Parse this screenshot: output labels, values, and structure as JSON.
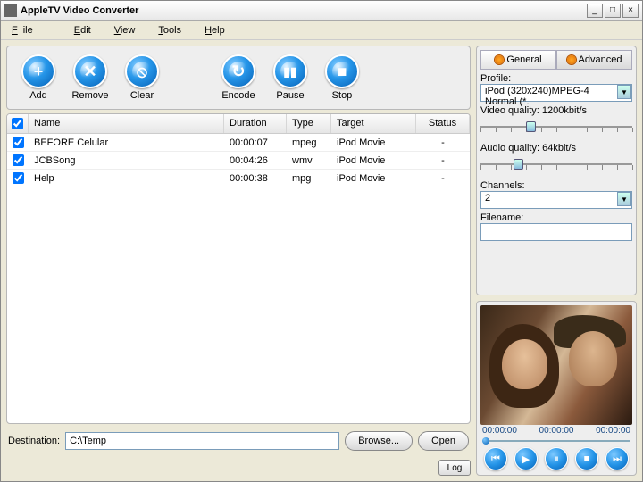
{
  "window": {
    "title": "AppleTV Video Converter"
  },
  "menu": {
    "file": "File",
    "edit": "Edit",
    "view": "View",
    "tools": "Tools",
    "help": "Help"
  },
  "toolbar": {
    "add": "Add",
    "remove": "Remove",
    "clear": "Clear",
    "encode": "Encode",
    "pause": "Pause",
    "stop": "Stop"
  },
  "table": {
    "headers": {
      "name": "Name",
      "duration": "Duration",
      "type": "Type",
      "target": "Target",
      "status": "Status"
    },
    "rows": [
      {
        "checked": true,
        "name": "BEFORE Celular",
        "duration": "00:00:07",
        "type": "mpeg",
        "target": "iPod Movie",
        "status": "-"
      },
      {
        "checked": true,
        "name": "JCBSong",
        "duration": "00:04:26",
        "type": "wmv",
        "target": "iPod Movie",
        "status": "-"
      },
      {
        "checked": true,
        "name": "Help",
        "duration": "00:00:38",
        "type": "mpg",
        "target": "iPod Movie",
        "status": "-"
      }
    ]
  },
  "destination": {
    "label": "Destination:",
    "value": "C:\\Temp",
    "browse": "Browse...",
    "open": "Open"
  },
  "log": "Log",
  "tabs": {
    "general": "General",
    "advanced": "Advanced"
  },
  "profile": {
    "label": "Profile:",
    "value": "iPod (320x240)MPEG-4 Normal (*."
  },
  "videoq": {
    "label": "Video quality: 1200kbit/s",
    "pos": 30
  },
  "audioq": {
    "label": "Audio quality: 64kbit/s",
    "pos": 22
  },
  "channels": {
    "label": "Channels:",
    "value": "2"
  },
  "filename": {
    "label": "Filename:",
    "value": ""
  },
  "preview": {
    "t1": "00:00:00",
    "t2": "00:00:00",
    "t3": "00:00:00"
  }
}
